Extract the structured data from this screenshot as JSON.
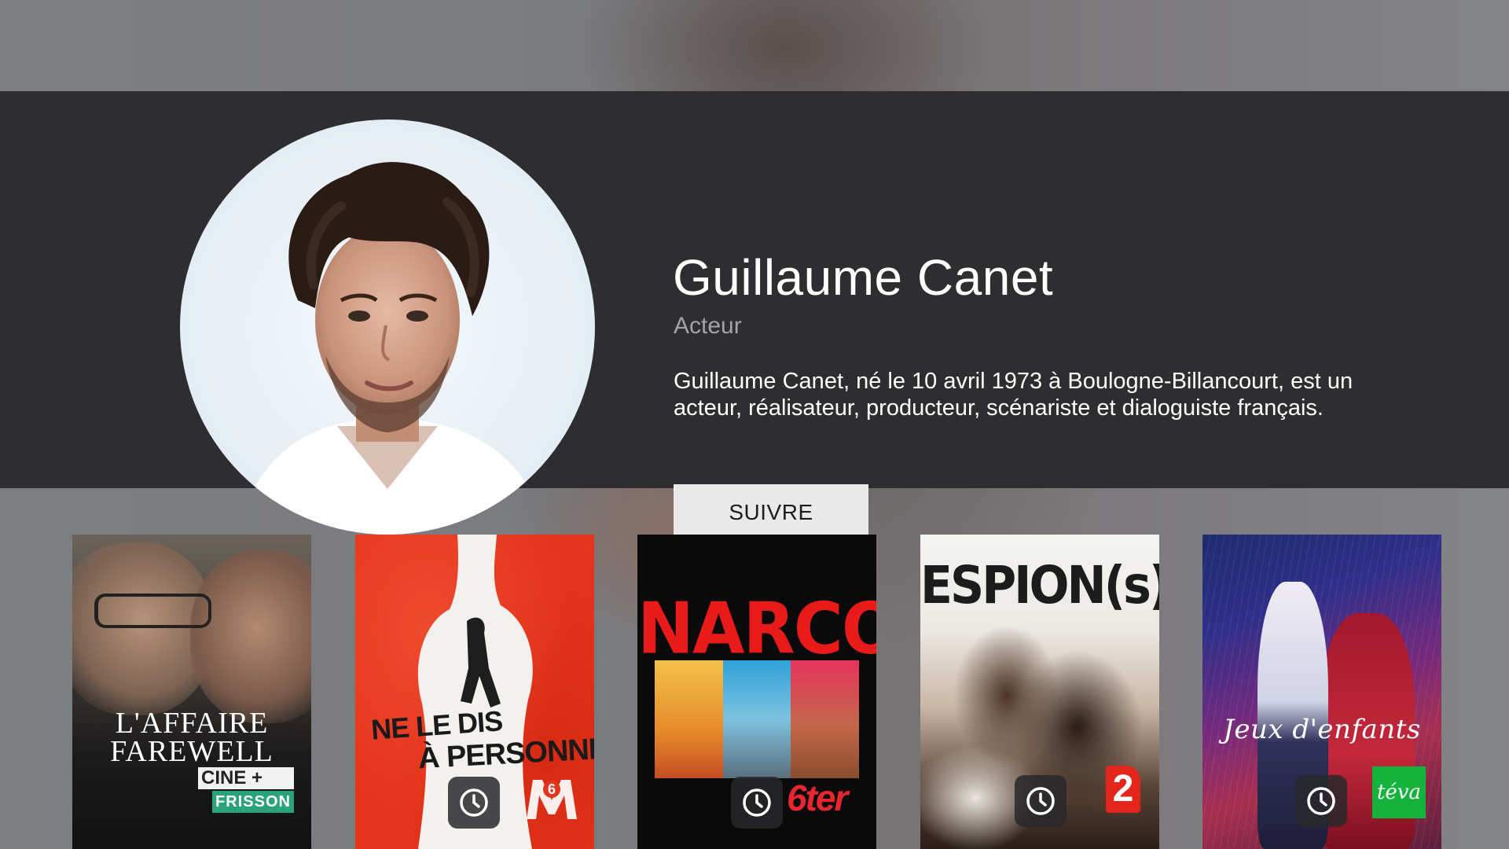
{
  "person": {
    "name": "Guillaume Canet",
    "role": "Acteur",
    "bio": "Guillaume Canet, né le 10 avril 1973 à Boulogne-Billancourt, est un acteur, réalisateur, producteur, scénariste et dialoguiste français.",
    "follow_label": "SUIVRE",
    "portrait_icon": "person-portrait"
  },
  "colors": {
    "hero_background": "#2e2d30",
    "page_background": "#7a7b7e",
    "follow_button": "#e9e9e9",
    "role_text": "#a3a3a6"
  },
  "filmography": [
    {
      "title_line1": "L'AFFAIRE",
      "title_line2": "FAREWELL",
      "channel_line1": "CINE +",
      "channel_line2": "FRISSON",
      "has_reminder": false
    },
    {
      "title_line1": "NE LE DIS",
      "title_line2": "À PERSONNE",
      "channel": "M6",
      "has_reminder": true,
      "reminder_icon": "clock-icon"
    },
    {
      "title": "NARCO",
      "channel": "6ter",
      "has_reminder": true,
      "reminder_icon": "clock-icon"
    },
    {
      "title": "ESPION(s)",
      "channel": "2",
      "has_reminder": true,
      "reminder_icon": "clock-icon"
    },
    {
      "title": "Jeux d'enfants",
      "channel": "téva",
      "has_reminder": true,
      "reminder_icon": "clock-icon"
    }
  ]
}
